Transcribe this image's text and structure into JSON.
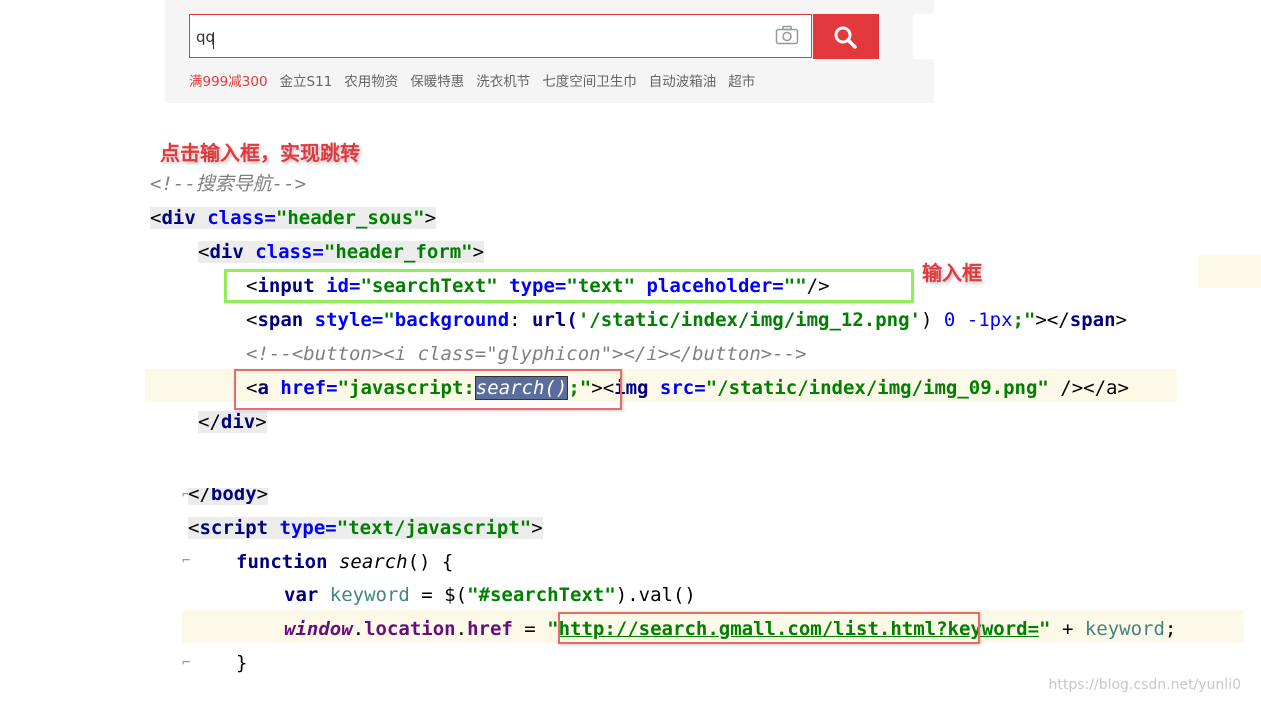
{
  "search": {
    "value": "qq",
    "hotwords": [
      "满999减300",
      "金立S11",
      "农用物资",
      "保暖特惠",
      "洗衣机节",
      "七度空间卫生巾",
      "自动波箱油",
      "超市"
    ]
  },
  "annotations": {
    "click_input": "点击输入框，实现跳转",
    "input_box": "输入框"
  },
  "code": {
    "comment_search_nav": "<!--搜索导航-->",
    "div_open": "<div",
    "class_attr": "class=",
    "header_sous_val": "\"header_sous\"",
    "header_form_val": "\"header_form\"",
    "input_tag": "input",
    "id_attr": "id=",
    "search_text_val": "\"searchText\"",
    "type_attr": "type=",
    "text_val": "\"text\"",
    "placeholder_attr": "placeholder=",
    "empty_val": "\"\"",
    "span_tag": "span",
    "style_attr": "style=",
    "style_val_open": "\"",
    "style_prop": "background",
    "style_colon": ": ",
    "style_url": "url(",
    "style_path": "'/static/index/img/img_12.png'",
    "style_close_paren": ") ",
    "style_num1": "0",
    "style_num2": " -1px",
    "style_end": ";\"",
    "button_comment": "<!--<button><i class=\"glyphicon\"></i></button>-->",
    "a_tag": "a",
    "href_attr": "href=",
    "href_val_prefix": "\"javascript:",
    "href_selected": "search()",
    "href_val_suffix": ";\"",
    "img_tag": "img",
    "src_attr": "src=",
    "src_val": "\"/static/index/img/img_09.png\"",
    "a_close": " /></a>",
    "div_close": "</div>",
    "body_close": "</body>",
    "script_tag": "script",
    "script_type_val": "\"text/javascript\"",
    "function_kw": "function",
    "function_name": "search",
    "function_sig": "() {",
    "var_kw": "var",
    "keyword_var": "keyword",
    "jquery_call": " = $(",
    "selector_str": "\"#searchText\"",
    "val_call": ").val()",
    "window_obj": "window",
    "location_prop": "location",
    "href_prop": "href",
    "assign": " = ",
    "url_str_open": "\"",
    "url_text": "http://search.gmall.com/list.html?keyword=",
    "url_str_close": "\"",
    "concat": " + ",
    "keyword_ref": "keyword",
    "semicolon": ";",
    "brace_close": "}"
  },
  "watermark": "https://blog.csdn.net/yunli0"
}
